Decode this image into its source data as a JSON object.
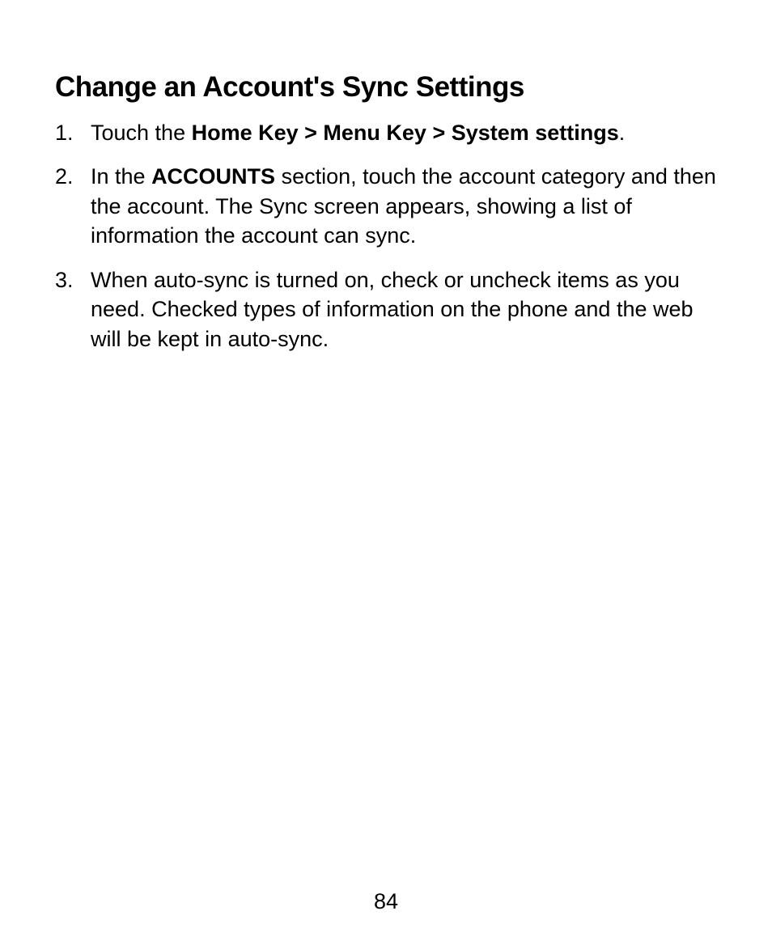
{
  "heading": "Change an Account's Sync Settings",
  "items": [
    {
      "number": "1.",
      "parts": [
        {
          "text": "Touch the ",
          "bold": false
        },
        {
          "text": "Home Key > Menu Key > System settings",
          "bold": true
        },
        {
          "text": ".",
          "bold": false
        }
      ]
    },
    {
      "number": "2.",
      "parts": [
        {
          "text": "In the ",
          "bold": false
        },
        {
          "text": "ACCOUNTS",
          "bold": true
        },
        {
          "text": " section, touch the account category and then the account. The Sync screen appears, showing a list of information the account can sync.",
          "bold": false
        }
      ]
    },
    {
      "number": "3.",
      "parts": [
        {
          "text": "When auto-sync is turned on, check or uncheck items as you need. Checked types of information on the phone and the web will be kept in auto-sync.",
          "bold": false
        }
      ]
    }
  ],
  "pageNumber": "84"
}
